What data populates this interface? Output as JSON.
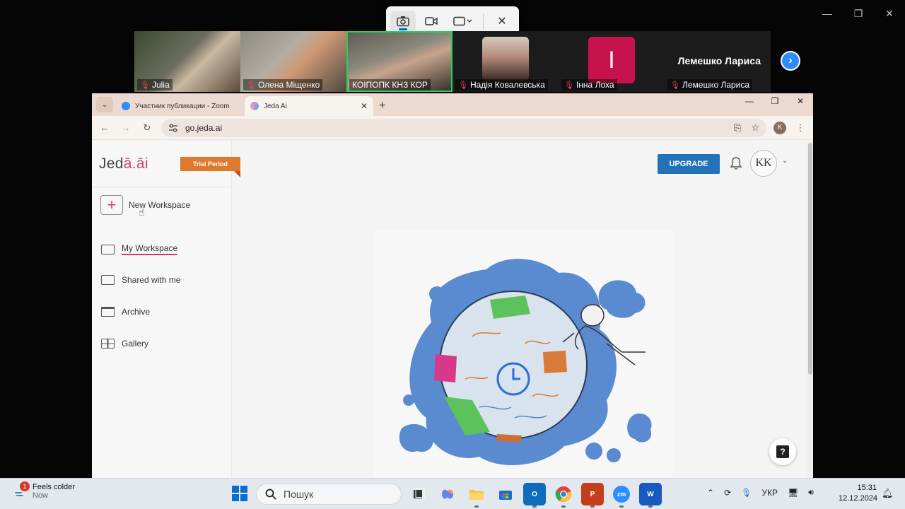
{
  "snip_toolbar": {
    "close": "✕"
  },
  "window_controls": {
    "minimize": "—",
    "restore": "❐",
    "close": "✕"
  },
  "participants": [
    {
      "name": "Julia"
    },
    {
      "name": "Олена Міщенко"
    },
    {
      "name": "КОІПОПК КНЗ КОР"
    },
    {
      "name": "Надія Ковалевська"
    },
    {
      "name": "Інна Лоха",
      "avatar_letter": "І"
    },
    {
      "name": "Лемешко Лариса",
      "big_name": "Лемешко Лариса"
    }
  ],
  "browser": {
    "tabs": [
      {
        "title": "Участник публикации - Zoom",
        "favicon": "zoom-icon",
        "color": "#2d8cff"
      },
      {
        "title": "Jeda Ai",
        "favicon": "jeda-icon",
        "color": "#c98bd9"
      }
    ],
    "new_tab": "+",
    "url": "go.jeda.ai",
    "profile_letter": "K"
  },
  "jeda": {
    "logo": {
      "part1": "Jed",
      "part2": "ā.āi"
    },
    "trial_badge": "Trial Period",
    "new_workspace": "New Workspace",
    "nav": [
      {
        "label": "My Workspace",
        "active": true
      },
      {
        "label": "Shared with me"
      },
      {
        "label": "Archive"
      },
      {
        "label": "Gallery"
      }
    ],
    "upgrade": "UPGRADE",
    "user_initials": "KK",
    "help": "?",
    "accent_color": "#d0386a"
  },
  "taskbar": {
    "weather_badge": "1",
    "weather_title": "Feels colder",
    "weather_sub": "Now",
    "search_placeholder": "Пошук",
    "language": "УКР",
    "time": "15:31",
    "date": "12.12.2024"
  }
}
